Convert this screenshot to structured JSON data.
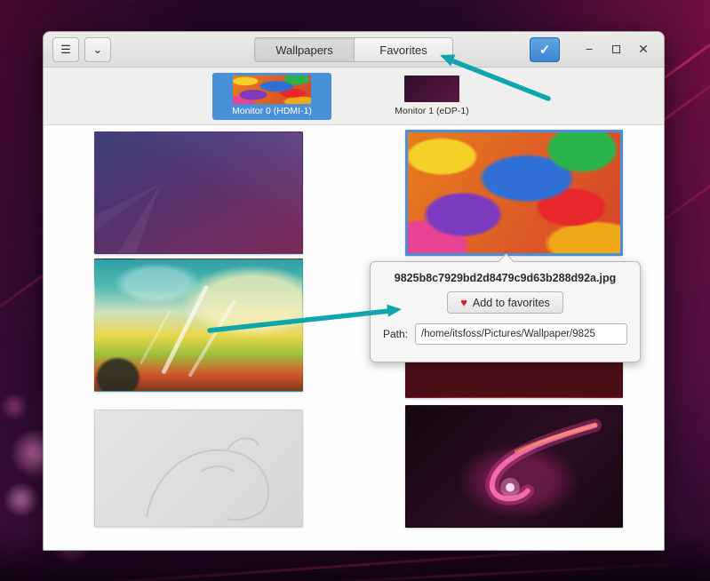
{
  "window": {
    "header": {
      "menu_icon": "☰",
      "expand_icon": "⌄",
      "tabs": [
        {
          "label": "Wallpapers",
          "active": true
        },
        {
          "label": "Favorites",
          "active": false
        }
      ],
      "check_icon": "✓",
      "minimize_icon": "−",
      "close_icon": "✕"
    },
    "monitor_bar": {
      "monitors": [
        {
          "label": "Monitor 0 (HDMI-1)",
          "selected": true
        },
        {
          "label": "Monitor 1 (eDP-1)",
          "selected": false
        }
      ]
    },
    "popover": {
      "filename": "9825b8c7929bd2d8479c9d63b288d92a.jpg",
      "heart_icon": "♥",
      "favorite_button_label": "Add to favorites",
      "path_label": "Path:",
      "path_value": "/home/itsfoss/Pictures/Wallpaper/9825"
    }
  },
  "colors": {
    "selection_blue": "#4a90d9",
    "arrow_teal": "#0fa5ad",
    "heart_red": "#e01b24"
  }
}
